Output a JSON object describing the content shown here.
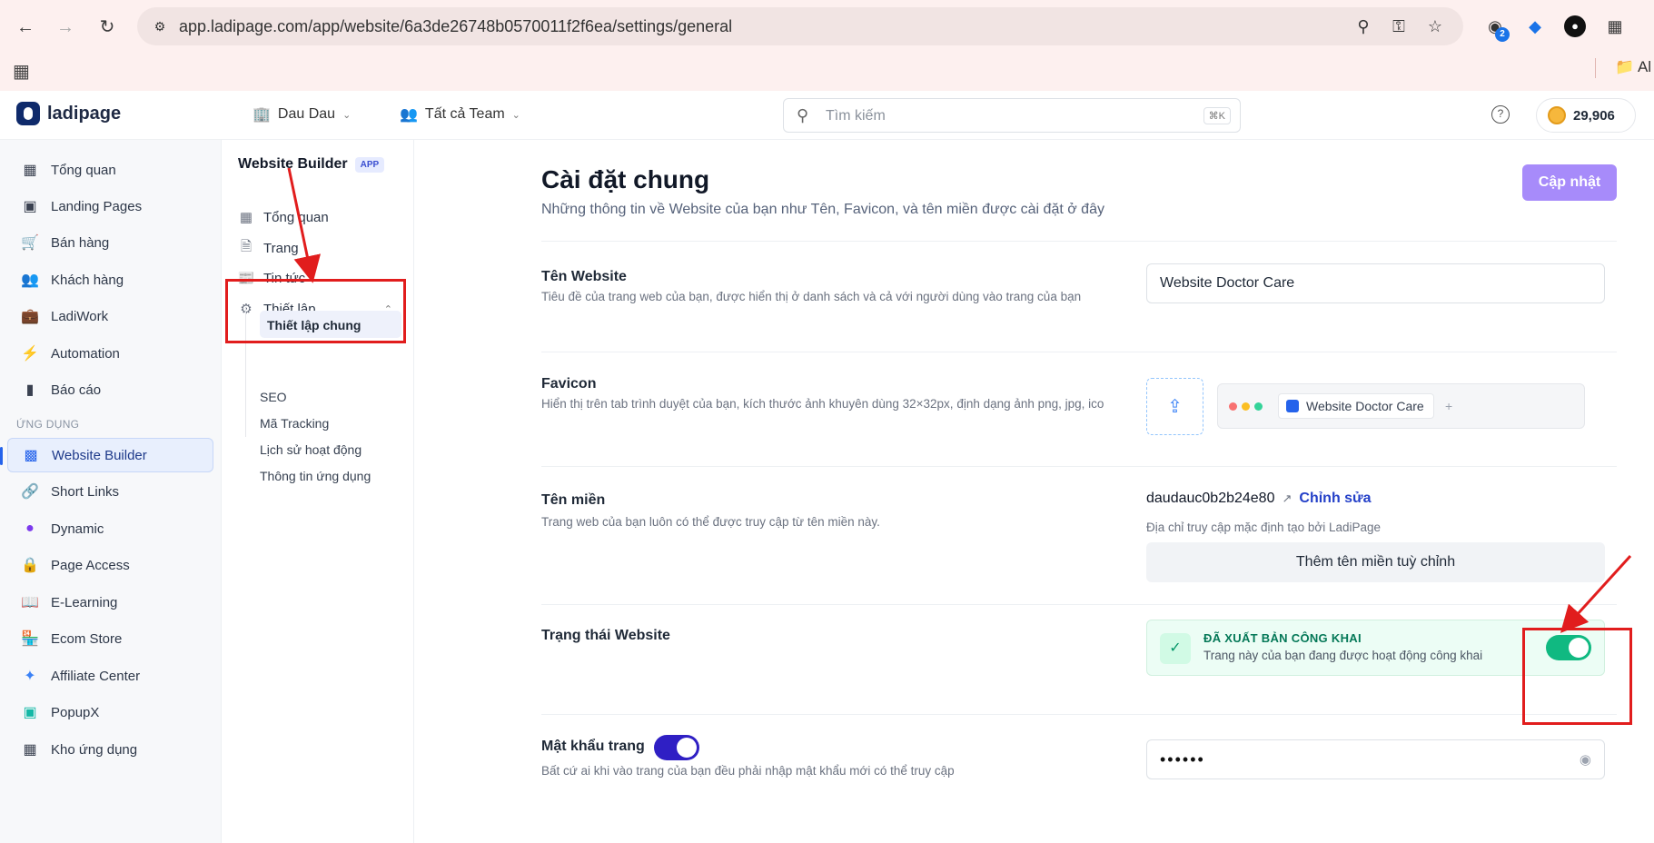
{
  "browser": {
    "url": "app.ladipage.com/app/website/6a3de26748b0570011f2f6ea/settings/general",
    "extension_badge": "2",
    "bookmark_folder": "Al"
  },
  "topbar": {
    "brand": "ladipage",
    "workspace": "Dau Dau",
    "team": "Tất cả Team",
    "search_placeholder": "Tìm kiếm",
    "search_shortcut": "⌘K",
    "credits": "29,906"
  },
  "sidebar": {
    "items": [
      {
        "label": "Tổng quan",
        "icon": "dashboard-icon"
      },
      {
        "label": "Landing Pages",
        "icon": "layout-icon"
      },
      {
        "label": "Bán hàng",
        "icon": "cart-icon"
      },
      {
        "label": "Khách hàng",
        "icon": "users-icon"
      },
      {
        "label": "LadiWork",
        "icon": "briefcase-icon"
      },
      {
        "label": "Automation",
        "icon": "lightning-icon"
      },
      {
        "label": "Báo cáo",
        "icon": "bar-chart-icon"
      }
    ],
    "section_label": "ỨNG DỤNG",
    "apps": [
      {
        "label": "Website Builder",
        "icon": "website-builder-icon"
      },
      {
        "label": "Short Links",
        "icon": "link-icon"
      },
      {
        "label": "Dynamic",
        "icon": "dynamic-icon"
      },
      {
        "label": "Page Access",
        "icon": "lock-page-icon"
      },
      {
        "label": "E-Learning",
        "icon": "book-icon"
      },
      {
        "label": "Ecom Store",
        "icon": "store-icon"
      },
      {
        "label": "Affiliate Center",
        "icon": "network-icon"
      },
      {
        "label": "PopupX",
        "icon": "popup-icon"
      },
      {
        "label": "Kho ứng dụng",
        "icon": "apps-grid-icon"
      }
    ]
  },
  "subnav": {
    "title": "Website Builder",
    "badge": "APP",
    "items": [
      {
        "label": "Tổng quan"
      },
      {
        "label": "Trang"
      },
      {
        "label": "Tin tức"
      },
      {
        "label": "Thiết lập"
      }
    ],
    "settings_children": [
      "Thiết lập chung",
      "SEO",
      "Mã Tracking",
      "Lịch sử hoạt động",
      "Thông tin ứng dụng"
    ]
  },
  "main": {
    "title": "Cài đặt chung",
    "subtitle": "Những thông tin về Website của bạn như Tên, Favicon, và tên miền được cài đặt ở đây",
    "update_button": "Cập nhật",
    "website_name": {
      "label": "Tên Website",
      "desc": "Tiêu đề của trang web của bạn, được hiển thị ở danh sách và cả với người dùng vào trang của bạn",
      "value": "Website Doctor Care"
    },
    "favicon": {
      "label": "Favicon",
      "desc": "Hiển thị trên tab trình duyệt của bạn, kích thước ảnh khuyên dùng 32×32px, định dạng ảnh png, jpg, ico",
      "preview_tab": "Website Doctor Care",
      "plus": "+"
    },
    "domain": {
      "label": "Tên miền",
      "desc": "Trang web của bạn luôn có thể được truy cập từ tên miền này.",
      "value": "daudauc0b2b24e80",
      "edit": "Chỉnh sửa",
      "note": "Địa chỉ truy cập mặc định tạo bởi LadiPage",
      "add_button": "Thêm tên miền tuỳ chỉnh"
    },
    "status": {
      "label": "Trạng thái Website",
      "title": "ĐÃ XUẤT BẢN CÔNG KHAI",
      "desc": "Trang này của bạn đang được hoạt động công khai",
      "enabled": true,
      "color": "#10b981"
    },
    "password": {
      "label": "Mật khẩu trang",
      "desc": "Bất cứ ai khi vào trang của bạn đều phải nhập mật khẩu mới có thể truy cập",
      "value": "••••••",
      "enabled": true,
      "color": "#2f1fc4"
    }
  },
  "colors": {
    "accent": "#2563eb",
    "update_button": "#a78bfa",
    "annotation": "#e11d1d"
  }
}
